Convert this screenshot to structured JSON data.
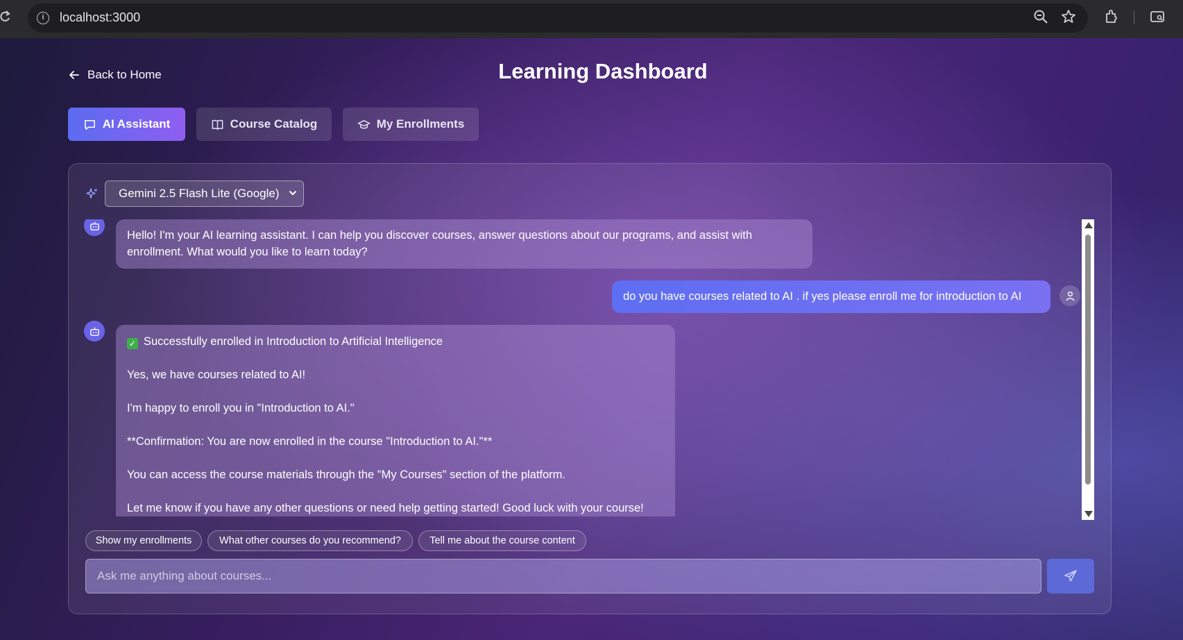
{
  "browser": {
    "url": "localhost:3000",
    "icons": [
      "reload-icon",
      "info-icon",
      "zoom-icon",
      "star-icon",
      "extensions-icon",
      "tab-search-icon"
    ]
  },
  "header": {
    "back_label": "Back to Home",
    "title": "Learning Dashboard"
  },
  "tabs": [
    {
      "label": "AI Assistant",
      "icon": "chat-icon",
      "active": true
    },
    {
      "label": "Course Catalog",
      "icon": "book-icon",
      "active": false
    },
    {
      "label": "My Enrollments",
      "icon": "graduation-cap-icon",
      "active": false
    }
  ],
  "chat": {
    "model_selected": "Gemini 2.5 Flash Lite (Google)",
    "messages": [
      {
        "role": "assistant",
        "lines": [
          "Hello! I'm your AI learning assistant. I can help you discover courses, answer questions about our programs, and assist with enrollment. What would you like to learn today?"
        ]
      },
      {
        "role": "user",
        "text": "do you have courses related to AI . if yes please enroll me for introduction to AI"
      },
      {
        "role": "assistant",
        "lines": [
          "Successfully enrolled in Introduction to Artificial Intelligence",
          "Yes, we have courses related to AI!",
          "I'm happy to enroll you in \"Introduction to AI.\"",
          "**Confirmation: You are now enrolled in the course \"Introduction to AI.\"**",
          "You can access the course materials through the \"My Courses\" section of the platform.",
          "Let me know if you have any other questions or need help getting started! Good luck with your course!"
        ]
      }
    ],
    "suggestions": [
      "Show my enrollments",
      "What other courses do you recommend?",
      "Tell me about the course content"
    ],
    "input_placeholder": "Ask me anything about courses..."
  },
  "colors": {
    "accent": "#5b6cf0",
    "accent_end": "#8f5ef0",
    "success": "#3eb04a"
  }
}
